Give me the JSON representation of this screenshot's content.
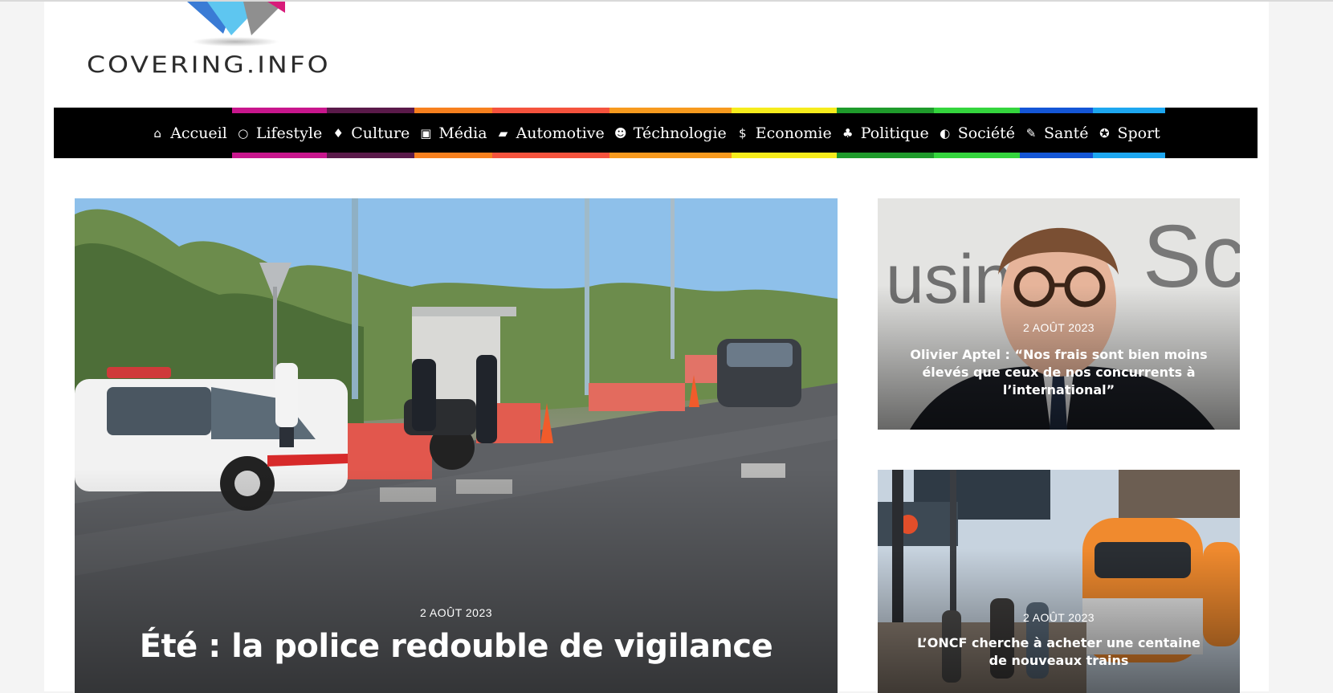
{
  "site": {
    "logo_text": "COVERING.INFO"
  },
  "nav": {
    "items": [
      {
        "label": "Accueil",
        "icon": "home-icon",
        "color": ""
      },
      {
        "label": "Lifestyle",
        "icon": "circle-icon",
        "color": "#c8168d"
      },
      {
        "label": "Culture",
        "icon": "lightbulb-icon",
        "color": "#5a1a4a"
      },
      {
        "label": "Média",
        "icon": "media-icon",
        "color": "#f7801e"
      },
      {
        "label": "Automotive",
        "icon": "car-icon",
        "color": "#f5533d"
      },
      {
        "label": "Téchnologie",
        "icon": "robot-icon",
        "color": "#f79a1e"
      },
      {
        "label": "Economie",
        "icon": "dollar-icon",
        "color": "#f6ec1c"
      },
      {
        "label": "Politique",
        "icon": "people-icon",
        "color": "#1f9b2b"
      },
      {
        "label": "Société",
        "icon": "globe-icon",
        "color": "#34d53d"
      },
      {
        "label": "Santé",
        "icon": "notepad-icon",
        "color": "#1456d6"
      },
      {
        "label": "Sport",
        "icon": "sport-icon",
        "color": "#1da7f0"
      }
    ]
  },
  "featured": {
    "date": "2 AOÛT 2023",
    "title": "Été : la police redouble de vigilance"
  },
  "side_posts": [
    {
      "date": "2 AOÛT 2023",
      "title": "Olivier Aptel : “Nos frais sont bien moins élevés que ceux de nos concurrents à l’international”"
    },
    {
      "date": "2 AOÛT 2023",
      "title": "L’ONCF cherche à acheter une centaine de nouveaux trains"
    }
  ]
}
